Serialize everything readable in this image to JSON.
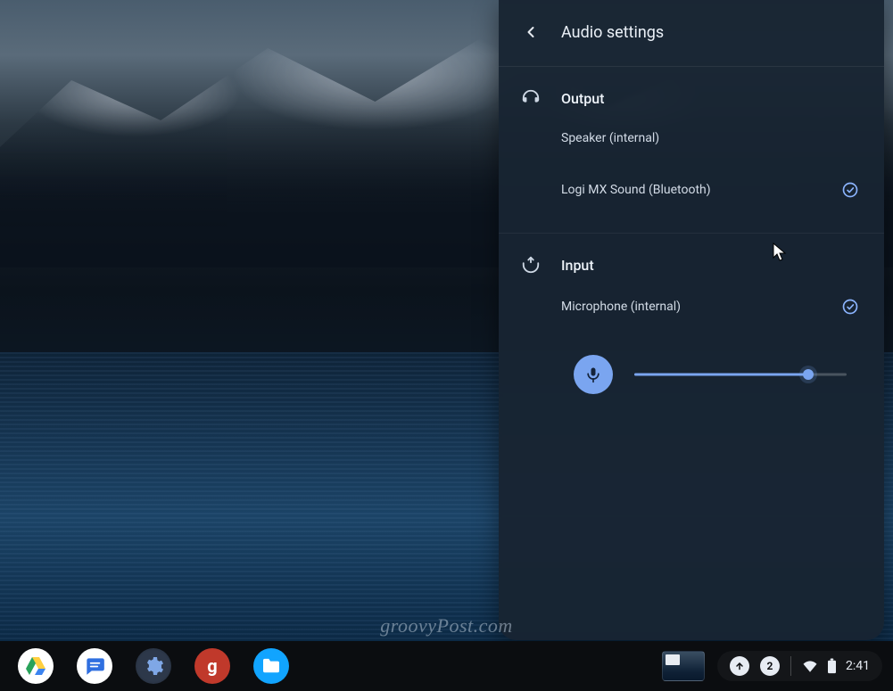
{
  "panel": {
    "title": "Audio settings",
    "output": {
      "heading": "Output",
      "devices": [
        {
          "label": "Speaker (internal)",
          "selected": false
        },
        {
          "label": "Logi MX Sound (Bluetooth)",
          "selected": true
        }
      ]
    },
    "input": {
      "heading": "Input",
      "devices": [
        {
          "label": "Microphone (internal)",
          "selected": true
        }
      ],
      "mic_level_percent": 82
    }
  },
  "shelf": {
    "apps": [
      {
        "name": "google-drive",
        "label": "Google Drive"
      },
      {
        "name": "messages",
        "label": "Messages"
      },
      {
        "name": "settings",
        "label": "Settings"
      },
      {
        "name": "groovypost",
        "label": "g"
      },
      {
        "name": "files",
        "label": "Files"
      }
    ],
    "status": {
      "update_icon": "update",
      "notification_count": "2",
      "wifi": "wifi-full",
      "battery": "battery-full",
      "clock": "2:41"
    }
  },
  "watermark": "groovyPost.com",
  "colors": {
    "accent": "#7aa5f0",
    "panel_bg": "rgba(24,36,50,0.96)"
  }
}
